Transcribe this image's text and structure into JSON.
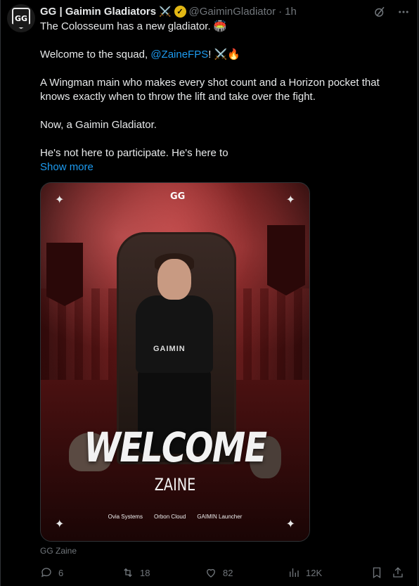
{
  "tweet": {
    "author_name": "GG | Gaimin Gladiators",
    "name_emoji": "⚔️",
    "handle": "@GaiminGladiator",
    "separator": "·",
    "time": "1h",
    "text": {
      "line1": "The Colosseum has a new gladiator. 🏟️",
      "welcome_prefix": "Welcome to the squad, ",
      "mention": "@ZaineFPS",
      "welcome_suffix": "! ⚔️🔥",
      "para3": "A Wingman main who makes every shot count and a Horizon pocket that knows exactly when to throw the lift and take over the fight.",
      "para4": "Now, a Gaimin Gladiator.",
      "para5": "He's not here to participate. He's here to",
      "show_more": "Show more"
    },
    "media": {
      "headline": "WELCOME",
      "player": "ZAINE",
      "jersey": "GAIMIN",
      "sponsors": [
        "Ovia Systems",
        "Orbon Cloud",
        "GAIMIN Launcher"
      ]
    },
    "caption": "GG Zaine",
    "stats": {
      "replies": "6",
      "reposts": "18",
      "likes": "82",
      "views": "12K"
    }
  },
  "colors": {
    "background": "#000000",
    "text": "#e7e9ea",
    "muted": "#71767b",
    "link": "#1d9bf0",
    "verified": "#e2b714"
  }
}
